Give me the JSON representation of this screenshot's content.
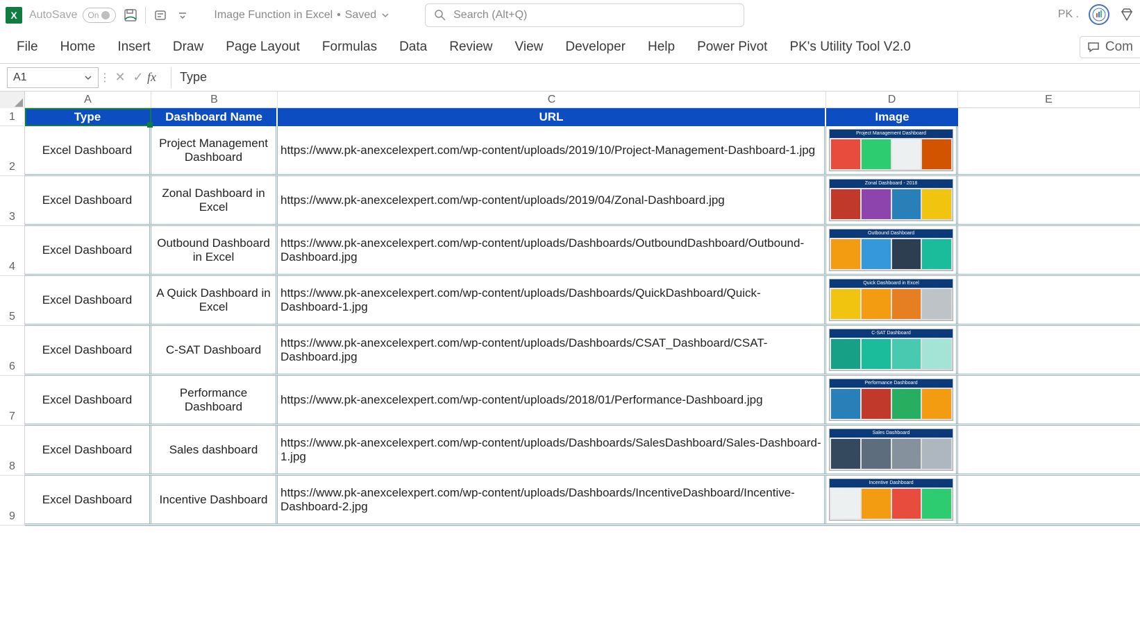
{
  "titleBar": {
    "autosave_label": "AutoSave",
    "autosave_state": "On",
    "doc_title": "Image Function in Excel",
    "saved_label": "Saved",
    "search_placeholder": "Search (Alt+Q)",
    "user_initials": "PK ."
  },
  "ribbon": {
    "tabs": [
      "File",
      "Home",
      "Insert",
      "Draw",
      "Page Layout",
      "Formulas",
      "Data",
      "Review",
      "View",
      "Developer",
      "Help",
      "Power Pivot",
      "PK's Utility Tool V2.0"
    ],
    "comments_label": "Com"
  },
  "formulaBar": {
    "name_box": "A1",
    "formula": "Type"
  },
  "columns": [
    "A",
    "B",
    "C",
    "D",
    "E"
  ],
  "rowNumbers": [
    "1",
    "2",
    "3",
    "4",
    "5",
    "6",
    "7",
    "8",
    "9"
  ],
  "headers": {
    "type": "Type",
    "name": "Dashboard Name",
    "url": "URL",
    "image": "Image"
  },
  "rows": [
    {
      "type": "Excel Dashboard",
      "name": "Project Management Dashboard",
      "url": "https://www.pk-anexcelexpert.com/wp-content/uploads/2019/10/Project-Management-Dashboard-1.jpg",
      "img_alt": "Project Management Dashboard"
    },
    {
      "type": "Excel Dashboard",
      "name": "Zonal Dashboard in Excel",
      "url": "https://www.pk-anexcelexpert.com/wp-content/uploads/2019/04/Zonal-Dashboard.jpg",
      "img_alt": "Zonal Dashboard - 2018"
    },
    {
      "type": "Excel Dashboard",
      "name": "Outbound Dashboard in Excel",
      "url": "https://www.pk-anexcelexpert.com/wp-content/uploads/Dashboards/OutboundDashboard/Outbound-Dashboard.jpg",
      "img_alt": "Outbound Dashboard"
    },
    {
      "type": "Excel Dashboard",
      "name": "A Quick Dashboard in Excel",
      "url": "https://www.pk-anexcelexpert.com/wp-content/uploads/Dashboards/QuickDashboard/Quick-Dashboard-1.jpg",
      "img_alt": "Quick Dashboard in Excel"
    },
    {
      "type": "Excel Dashboard",
      "name": "C-SAT Dashboard",
      "url": "https://www.pk-anexcelexpert.com/wp-content/uploads/Dashboards/CSAT_Dashboard/CSAT-Dashboard.jpg",
      "img_alt": "C-SAT Dashboard"
    },
    {
      "type": "Excel Dashboard",
      "name": "Performance Dashboard",
      "url": "https://www.pk-anexcelexpert.com/wp-content/uploads/2018/01/Performance-Dashboard.jpg",
      "img_alt": "Performance Dashboard"
    },
    {
      "type": "Excel Dashboard",
      "name": "Sales dashboard",
      "url": "https://www.pk-anexcelexpert.com/wp-content/uploads/Dashboards/SalesDashboard/Sales-Dashboard-1.jpg",
      "img_alt": "Sales Dashboard"
    },
    {
      "type": "Excel Dashboard",
      "name": "Incentive Dashboard",
      "url": "https://www.pk-anexcelexpert.com/wp-content/uploads/Dashboards/IncentiveDashboard/Incentive-Dashboard-2.jpg",
      "img_alt": "Incentive Dashboard"
    }
  ],
  "thumbColors": [
    [
      "#e74c3c",
      "#2ecc71",
      "#ecf0f1",
      "#d35400"
    ],
    [
      "#c0392b",
      "#8e44ad",
      "#2980b9",
      "#f1c40f"
    ],
    [
      "#f39c12",
      "#3498db",
      "#2c3e50",
      "#1abc9c"
    ],
    [
      "#f1c40f",
      "#f39c12",
      "#e67e22",
      "#bdc3c7"
    ],
    [
      "#16a085",
      "#1abc9c",
      "#48c9b0",
      "#a3e4d7"
    ],
    [
      "#2980b9",
      "#c0392b",
      "#27ae60",
      "#f39c12"
    ],
    [
      "#34495e",
      "#5d6d7e",
      "#85929e",
      "#aeb6bf"
    ],
    [
      "#ecf0f1",
      "#f39c12",
      "#e74c3c",
      "#2ecc71"
    ]
  ]
}
